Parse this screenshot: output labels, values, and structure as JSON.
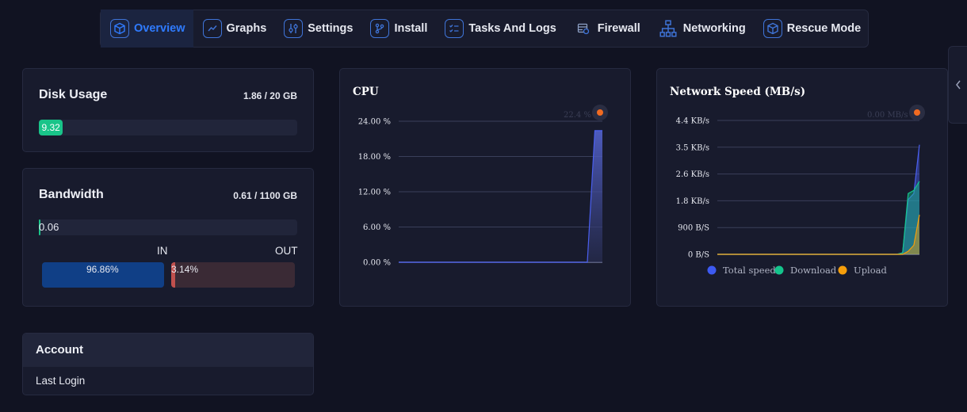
{
  "nav": {
    "items": [
      {
        "label": "Overview",
        "icon": "cube-icon",
        "active": true
      },
      {
        "label": "Graphs",
        "icon": "line-chart-icon",
        "active": false
      },
      {
        "label": "Settings",
        "icon": "sliders-icon",
        "active": false
      },
      {
        "label": "Install",
        "icon": "git-branch-icon",
        "active": false
      },
      {
        "label": "Tasks And Logs",
        "icon": "checklist-icon",
        "active": false
      },
      {
        "label": "Firewall",
        "icon": "firewall-icon",
        "active": false
      },
      {
        "label": "Networking",
        "icon": "network-icon",
        "active": false
      },
      {
        "label": "Rescue Mode",
        "icon": "cube-icon",
        "active": false
      }
    ]
  },
  "disk": {
    "title": "Disk Usage",
    "meta": "1.86 / 20 GB",
    "value": "9.32",
    "percent": 9.32
  },
  "bandwidth": {
    "title": "Bandwidth",
    "meta": "0.61 / 1100 GB",
    "value": "0.06",
    "in_label": "IN",
    "out_label": "OUT",
    "in_value": "96.86%",
    "out_value": "3.14%"
  },
  "account": {
    "title": "Account",
    "last_login_label": "Last Login"
  },
  "cpu_chart": {
    "title": "CPU",
    "tooltip": "22.4 %",
    "y_ticks": [
      "24.00 %",
      "18.00 %",
      "12.00 %",
      "6.00 %",
      "0.00 %"
    ]
  },
  "net_chart": {
    "title": "Network Speed (MB/s)",
    "tooltip": "0.00 MB/s",
    "y_ticks": [
      "4.4 KB/s",
      "3.5 KB/s",
      "2.6 KB/s",
      "1.8 KB/s",
      "900 B/S",
      "0 B/S"
    ],
    "legend": [
      "Total speed",
      "Download",
      "Upload"
    ]
  },
  "chart_data": [
    {
      "type": "area",
      "title": "CPU",
      "ylim": [
        0,
        24
      ],
      "series": [
        {
          "values": [
            0,
            0,
            0,
            0,
            0,
            0,
            0,
            0,
            0,
            0,
            0,
            0,
            0,
            0,
            0,
            0,
            0,
            0,
            0,
            0,
            0,
            0,
            0,
            0,
            0,
            0,
            22.4,
            22.4
          ]
        }
      ]
    },
    {
      "type": "area",
      "title": "Network Speed (MB/s)",
      "ylim": [
        0,
        4.4
      ],
      "series": [
        {
          "name": "Total speed",
          "color": "#4a5ff0",
          "values": [
            0,
            0,
            0,
            0,
            0,
            0,
            0,
            0,
            0,
            0,
            0,
            0,
            0,
            0,
            0,
            0,
            0,
            0,
            0,
            0,
            0,
            0,
            0,
            0,
            0,
            0,
            0,
            0,
            0,
            0,
            0,
            0,
            0,
            0.05,
            1.8,
            2.0,
            3.6
          ]
        },
        {
          "name": "Download",
          "color": "#14c48c",
          "values": [
            0,
            0,
            0,
            0,
            0,
            0,
            0,
            0,
            0,
            0,
            0,
            0,
            0,
            0,
            0,
            0,
            0,
            0,
            0,
            0,
            0,
            0,
            0,
            0,
            0,
            0,
            0,
            0,
            0,
            0,
            0,
            0,
            0,
            0.05,
            2.0,
            2.1,
            2.4
          ]
        },
        {
          "name": "Upload",
          "color": "#f59e0b",
          "values": [
            0,
            0,
            0,
            0,
            0,
            0,
            0,
            0,
            0,
            0,
            0,
            0,
            0,
            0,
            0,
            0,
            0,
            0,
            0,
            0,
            0,
            0,
            0,
            0,
            0,
            0,
            0,
            0,
            0,
            0,
            0,
            0,
            0,
            0,
            0.1,
            0.3,
            1.3
          ]
        }
      ]
    }
  ]
}
